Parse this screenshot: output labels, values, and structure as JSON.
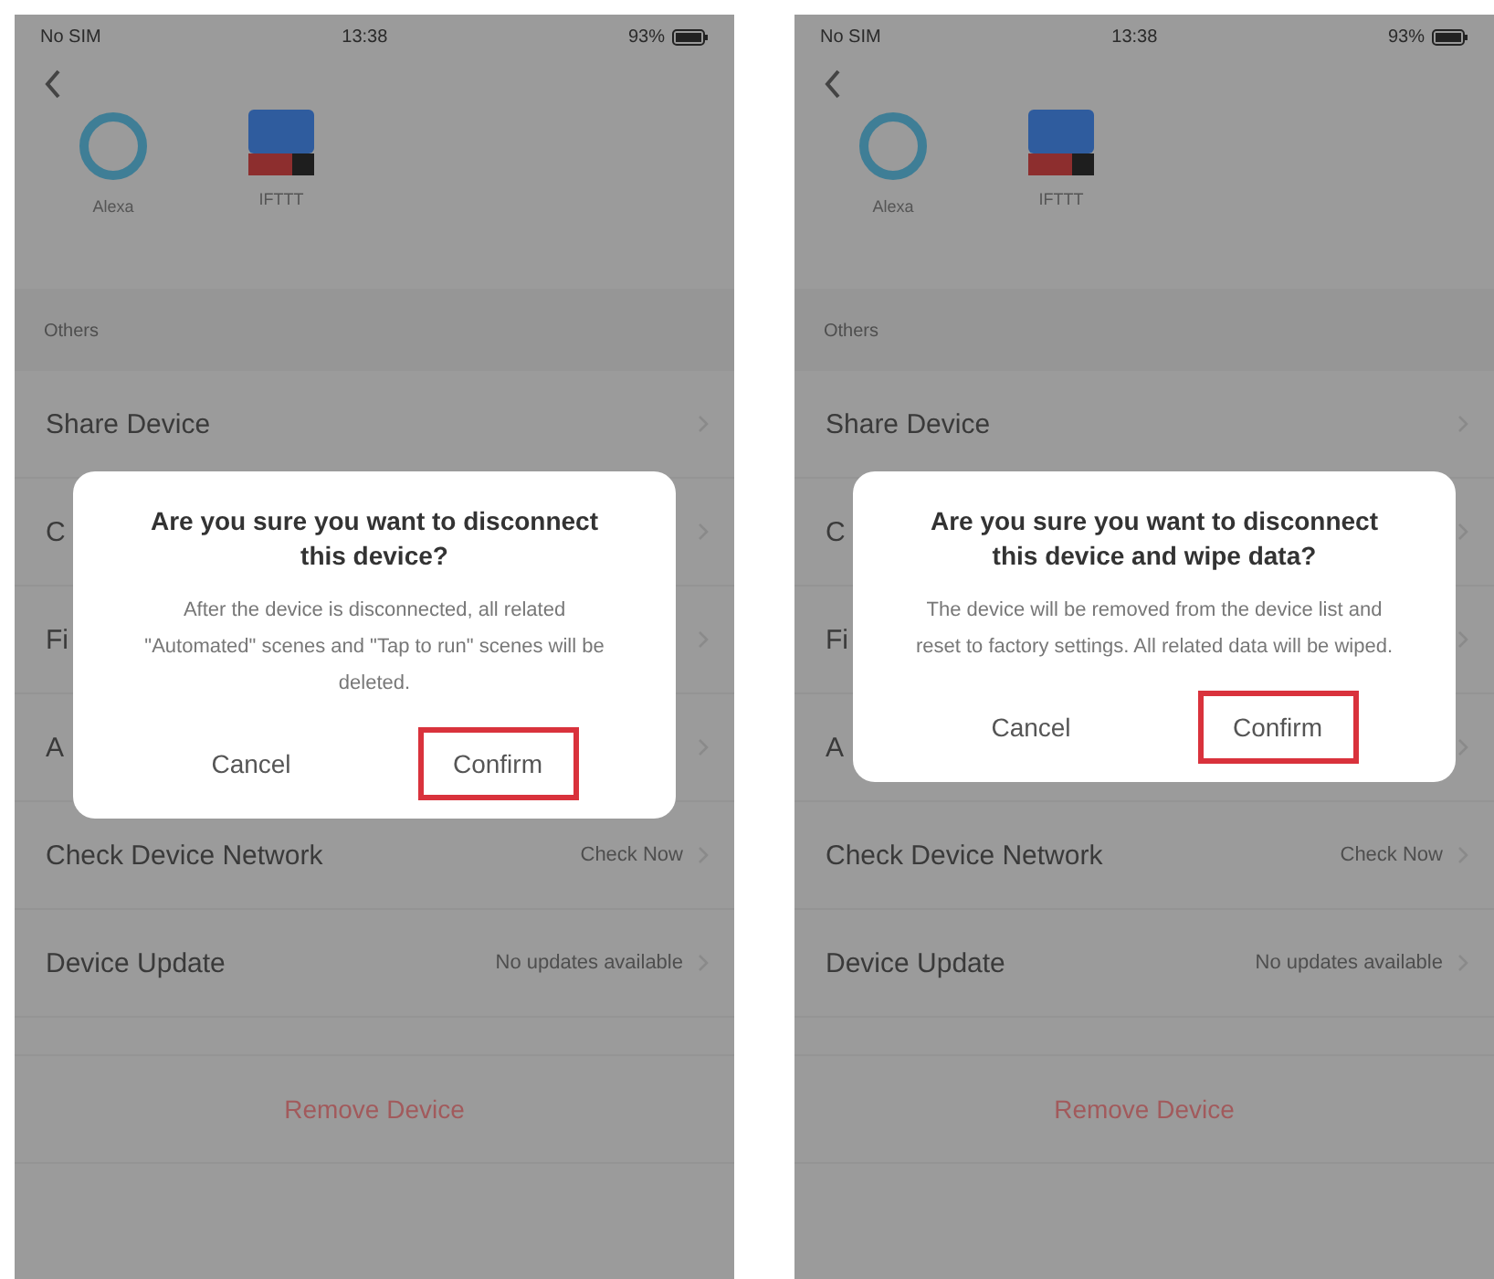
{
  "screens": [
    {
      "status_bar": {
        "carrier": "No SIM",
        "time": "13:38",
        "battery": "93%"
      },
      "integrations": [
        {
          "kind": "alexa",
          "label": "Alexa"
        },
        {
          "kind": "ifttt",
          "label": "IFTTT"
        }
      ],
      "section_header": "Others",
      "rows": [
        {
          "label": "Share Device"
        },
        {
          "label": "C"
        },
        {
          "label": "Fi"
        },
        {
          "label": "A"
        },
        {
          "label": "Check Device Network",
          "value": "Check Now"
        },
        {
          "label": "Device Update",
          "value": "No updates available"
        }
      ],
      "remove_button": "Remove Device",
      "dialog": {
        "title": "Are you sure you want to disconnect this device?",
        "message": "After the device is disconnected, all related \"Automated\" scenes and \"Tap to run\" scenes will be deleted.",
        "buttons": [
          {
            "label": "Cancel",
            "highlighted": false
          },
          {
            "label": "Confirm",
            "highlighted": true
          }
        ]
      }
    },
    {
      "status_bar": {
        "carrier": "No SIM",
        "time": "13:38",
        "battery": "93%"
      },
      "integrations": [
        {
          "kind": "alexa",
          "label": "Alexa"
        },
        {
          "kind": "ifttt",
          "label": "IFTTT"
        }
      ],
      "section_header": "Others",
      "rows": [
        {
          "label": "Share Device"
        },
        {
          "label": "C"
        },
        {
          "label": "Fi"
        },
        {
          "label": "A"
        },
        {
          "label": "Check Device Network",
          "value": "Check Now"
        },
        {
          "label": "Device Update",
          "value": "No updates available"
        }
      ],
      "remove_button": "Remove Device",
      "dialog": {
        "title": "Are you sure you want to disconnect this device and wipe data?",
        "message": "The device will be removed from the device list and reset to factory settings. All related data will be wiped.",
        "buttons": [
          {
            "label": "Cancel",
            "highlighted": false
          },
          {
            "label": "Confirm",
            "highlighted": true
          }
        ]
      }
    }
  ]
}
